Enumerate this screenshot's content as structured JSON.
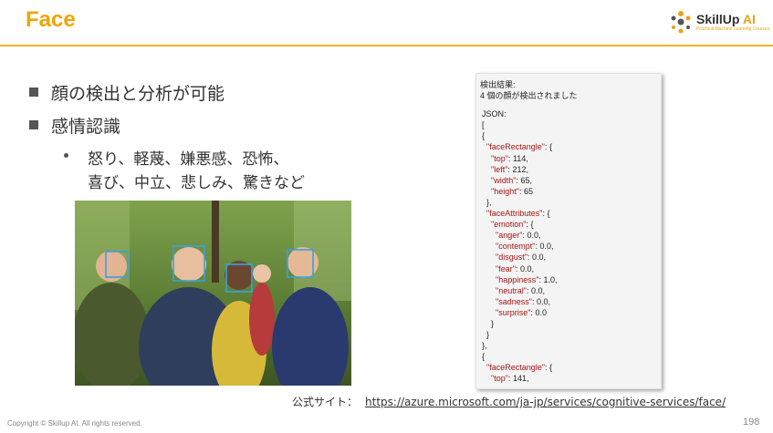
{
  "slide": {
    "title": "Face",
    "logo": {
      "name": "SkillUp",
      "ai": " AI",
      "tagline": "Practical Machine Learning Courses"
    },
    "bullets": [
      "顔の検出と分析が可能",
      "感情認識"
    ],
    "sub_bullet": {
      "line1": "怒り、軽蔑、嫌悪感、恐怖、",
      "line2": "喜び、中立、悲しみ、驚きなど"
    },
    "source_label": "公式サイト：",
    "source_url": "https://azure.microsoft.com/ja-jp/services/cognitive-services/face/",
    "copyright": "Copyright © Skillup AI. All rights reserved.",
    "page_number": "198"
  },
  "json_panel": {
    "header": [
      "検出結果:",
      "4 個の顔が検出されました"
    ],
    "label": "JSON:",
    "lines": [
      [
        [
          "punc",
          "["
        ]
      ],
      [
        [
          "punc",
          "{"
        ]
      ],
      [
        [
          "punc",
          "  "
        ],
        [
          "key",
          "\"faceRectangle\""
        ],
        [
          "punc",
          ": {"
        ]
      ],
      [
        [
          "punc",
          "    "
        ],
        [
          "key",
          "\"top\""
        ],
        [
          "punc",
          ": "
        ],
        [
          "num",
          "114"
        ],
        [
          "punc",
          ","
        ]
      ],
      [
        [
          "punc",
          "    "
        ],
        [
          "key",
          "\"left\""
        ],
        [
          "punc",
          ": "
        ],
        [
          "num",
          "212"
        ],
        [
          "punc",
          ","
        ]
      ],
      [
        [
          "punc",
          "    "
        ],
        [
          "key",
          "\"width\""
        ],
        [
          "punc",
          ": "
        ],
        [
          "num",
          "65"
        ],
        [
          "punc",
          ","
        ]
      ],
      [
        [
          "punc",
          "    "
        ],
        [
          "key",
          "\"height\""
        ],
        [
          "punc",
          ": "
        ],
        [
          "num",
          "65"
        ]
      ],
      [
        [
          "punc",
          "  },"
        ]
      ],
      [
        [
          "punc",
          "  "
        ],
        [
          "key",
          "\"faceAttributes\""
        ],
        [
          "punc",
          ": {"
        ]
      ],
      [
        [
          "punc",
          "    "
        ],
        [
          "key",
          "\"emotion\""
        ],
        [
          "punc",
          ": {"
        ]
      ],
      [
        [
          "punc",
          "      "
        ],
        [
          "key",
          "\"anger\""
        ],
        [
          "punc",
          ": "
        ],
        [
          "num",
          "0.0"
        ],
        [
          "punc",
          ","
        ]
      ],
      [
        [
          "punc",
          "      "
        ],
        [
          "key",
          "\"contempt\""
        ],
        [
          "punc",
          ": "
        ],
        [
          "num",
          "0.0"
        ],
        [
          "punc",
          ","
        ]
      ],
      [
        [
          "punc",
          "      "
        ],
        [
          "key",
          "\"disgust\""
        ],
        [
          "punc",
          ": "
        ],
        [
          "num",
          "0.0"
        ],
        [
          "punc",
          ","
        ]
      ],
      [
        [
          "punc",
          "      "
        ],
        [
          "key",
          "\"fear\""
        ],
        [
          "punc",
          ": "
        ],
        [
          "num",
          "0.0"
        ],
        [
          "punc",
          ","
        ]
      ],
      [
        [
          "punc",
          "      "
        ],
        [
          "key",
          "\"happiness\""
        ],
        [
          "punc",
          ": "
        ],
        [
          "num",
          "1.0"
        ],
        [
          "punc",
          ","
        ]
      ],
      [
        [
          "punc",
          "      "
        ],
        [
          "key",
          "\"neutral\""
        ],
        [
          "punc",
          ": "
        ],
        [
          "num",
          "0.0"
        ],
        [
          "punc",
          ","
        ]
      ],
      [
        [
          "punc",
          "      "
        ],
        [
          "key",
          "\"sadness\""
        ],
        [
          "punc",
          ": "
        ],
        [
          "num",
          "0.0"
        ],
        [
          "punc",
          ","
        ]
      ],
      [
        [
          "punc",
          "      "
        ],
        [
          "key",
          "\"surprise\""
        ],
        [
          "punc",
          ": "
        ],
        [
          "num",
          "0.0"
        ]
      ],
      [
        [
          "punc",
          "    }"
        ]
      ],
      [
        [
          "punc",
          "  }"
        ]
      ],
      [
        [
          "punc",
          "},"
        ]
      ],
      [
        [
          "punc",
          "{"
        ]
      ],
      [
        [
          "punc",
          "  "
        ],
        [
          "key",
          "\"faceRectangle\""
        ],
        [
          "punc",
          ": {"
        ]
      ],
      [
        [
          "punc",
          "    "
        ],
        [
          "key",
          "\"top\""
        ],
        [
          "punc",
          ": "
        ],
        [
          "num",
          "141"
        ],
        [
          "punc",
          ","
        ]
      ]
    ]
  },
  "colors": {
    "accent": "#f0a500",
    "rule": "#f0b429",
    "json_key": "#a31515",
    "face_box": "#3aa0e0"
  }
}
